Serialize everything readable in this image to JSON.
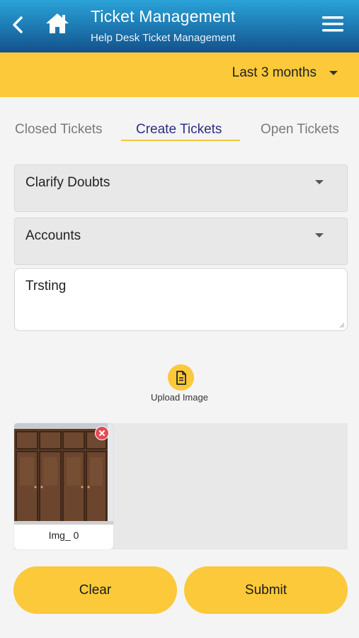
{
  "header": {
    "title": "Ticket Management",
    "subtitle": "Help Desk Ticket Management",
    "back_icon": "chevron-left-icon",
    "home_icon": "home-icon",
    "menu_icon": "hamburger-menu-icon"
  },
  "filter": {
    "selected": "Last 3 months"
  },
  "tabs": [
    {
      "label": "Closed Tickets",
      "active": false
    },
    {
      "label": "Create Tickets",
      "active": true
    },
    {
      "label": "Open Tickets",
      "active": false
    }
  ],
  "form": {
    "category": "Clarify Doubts",
    "department": "Accounts",
    "description": "Trsting"
  },
  "upload": {
    "label": "Upload Image",
    "icon": "document-icon"
  },
  "attachments": [
    {
      "caption": "Img_ 0",
      "remove_icon": "close-icon"
    }
  ],
  "actions": {
    "clear": "Clear",
    "submit": "Submit"
  },
  "colors": {
    "accent_yellow": "#fbc93a",
    "header_blue": "#1d77b0",
    "active_tab_text": "#2c2e85",
    "remove_red": "#e34c55"
  }
}
